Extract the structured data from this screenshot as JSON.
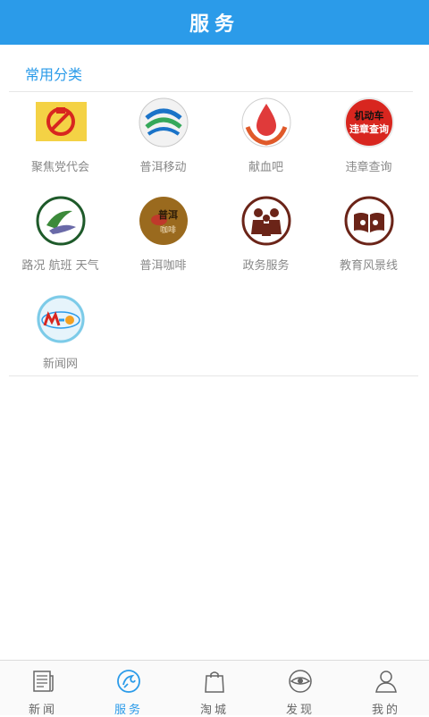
{
  "header": {
    "title": "服务"
  },
  "section": {
    "title": "常用分类"
  },
  "services": [
    {
      "label": "聚焦党代会",
      "icon": "party-flag-icon"
    },
    {
      "label": "普洱移动",
      "icon": "china-mobile-icon"
    },
    {
      "label": "献血吧",
      "icon": "blood-donation-icon"
    },
    {
      "label": "违章查询",
      "icon": "traffic-violation-icon",
      "icon_text_1": "机动车",
      "icon_text_2": "违章查询"
    },
    {
      "label": "路况 航班 天气",
      "icon": "traffic-flight-weather-icon"
    },
    {
      "label": "普洱咖啡",
      "icon": "puer-coffee-icon",
      "icon_text_1": "普洱",
      "icon_text_2": "咖啡"
    },
    {
      "label": "政务服务",
      "icon": "government-service-icon"
    },
    {
      "label": "教育风景线",
      "icon": "education-icon"
    },
    {
      "label": "新闻网",
      "icon": "news-site-icon"
    }
  ],
  "tabs": [
    {
      "label": "新闻",
      "icon": "newspaper-icon",
      "active": false
    },
    {
      "label": "服务",
      "icon": "service-icon",
      "active": true
    },
    {
      "label": "淘城",
      "icon": "shopping-bag-icon",
      "active": false
    },
    {
      "label": "发现",
      "icon": "discover-eye-icon",
      "active": false
    },
    {
      "label": "我的",
      "icon": "user-icon",
      "active": false
    }
  ],
  "colors": {
    "accent": "#2b9be9",
    "text_muted": "#888888",
    "party_red": "#d8261f",
    "coffee": "#7a4a18",
    "gov_brown": "#6b2418"
  }
}
